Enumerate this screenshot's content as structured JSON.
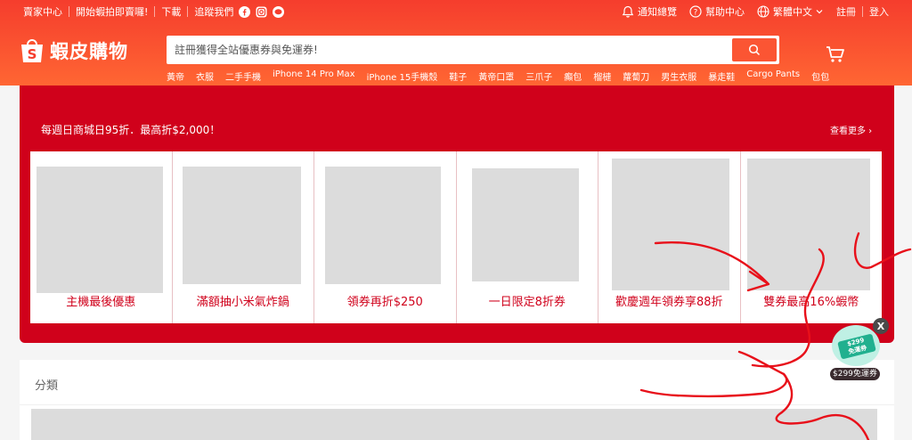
{
  "topbar": {
    "left": [
      "賣家中心",
      "開始蝦拍即賣囉!",
      "下載",
      "追蹤我們"
    ],
    "social_icons": [
      "facebook-icon",
      "instagram-icon",
      "line-icon"
    ],
    "right": {
      "notifications": "通知總覽",
      "help": "幫助中心",
      "language": "繁體中文",
      "register": "註冊",
      "login": "登入"
    }
  },
  "logo": {
    "text": "蝦皮購物"
  },
  "search": {
    "placeholder": "註冊獲得全站優惠券與免運券!"
  },
  "keywords": [
    "黃帝",
    "衣服",
    "二手手機",
    "iPhone 14 Pro Max",
    "iPhone 15手機殼",
    "鞋子",
    "黃帝口罩",
    "三爪子",
    "癲包",
    "榴槤",
    "蘿蔔刀",
    "男生衣服",
    "暴走鞋",
    "Cargo Pants",
    "包包"
  ],
  "mall": {
    "title": "每週日商城日95折．最高折$2,000！",
    "more": "查看更多",
    "cards": [
      {
        "label": "主機最後優惠"
      },
      {
        "label": "滿額抽小米氣炸鍋"
      },
      {
        "label": "領券再折$250"
      },
      {
        "label": "一日限定8折券"
      },
      {
        "label": "歡慶週年領券享88折"
      },
      {
        "label": "雙券最高16%蝦幣"
      }
    ]
  },
  "category": {
    "title": "分類"
  },
  "float_coupon": {
    "ticket": "$299\n免運券",
    "label": "$299免運券",
    "close": "X"
  },
  "colors": {
    "brand": "#ee4d2d",
    "mall_red": "#d0011b",
    "scribble": "#e8101a"
  }
}
